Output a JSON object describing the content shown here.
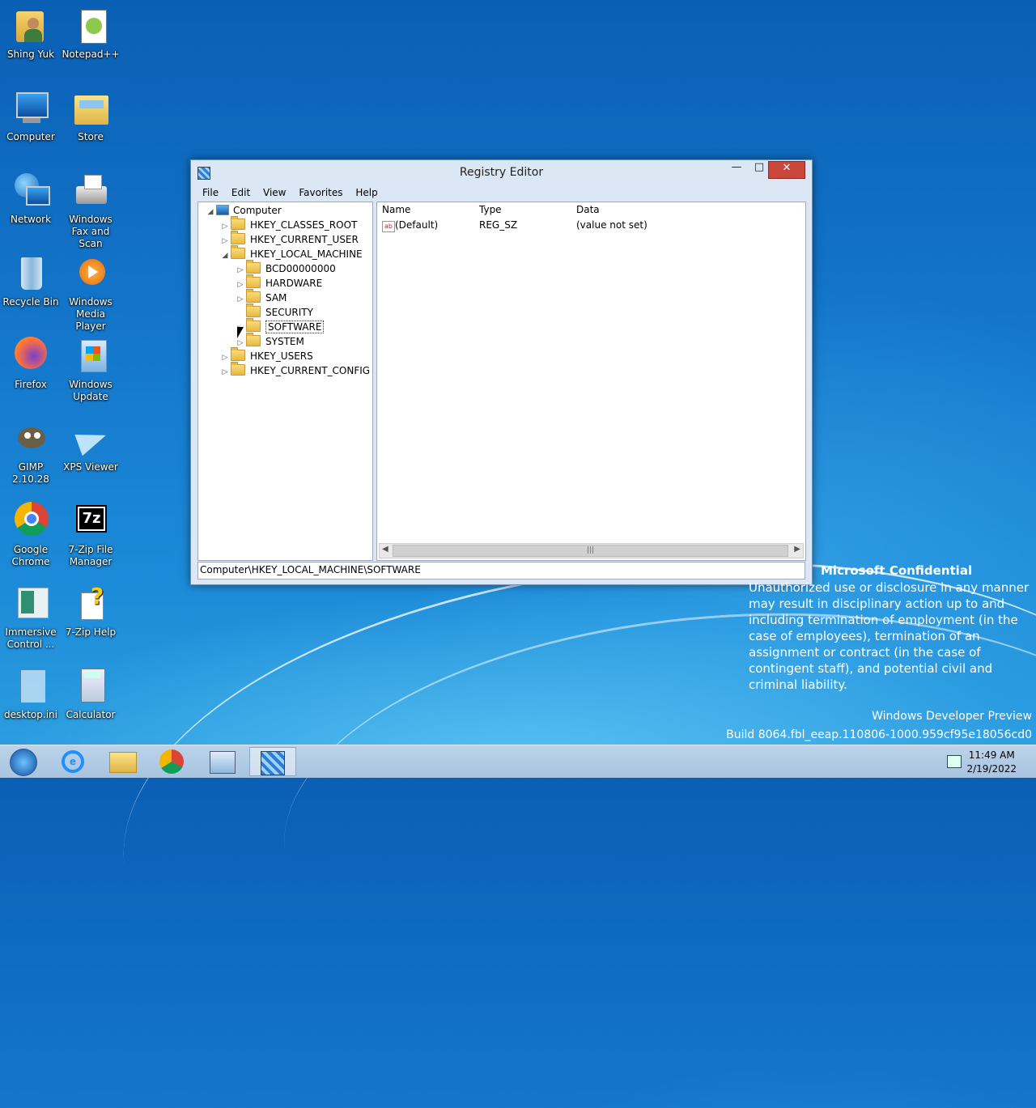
{
  "desktop": {
    "icons": [
      {
        "label": "Shing Yuk",
        "icon": "user-folder-icon"
      },
      {
        "label": "Notepad++",
        "icon": "notepadpp-icon"
      },
      {
        "label": "Computer",
        "icon": "computer-icon"
      },
      {
        "label": "Store",
        "icon": "store-folder-icon"
      },
      {
        "label": "Network",
        "icon": "network-icon"
      },
      {
        "label": "Windows Fax and Scan",
        "icon": "fax-icon"
      },
      {
        "label": "Recycle Bin",
        "icon": "recycle-bin-icon"
      },
      {
        "label": "Windows Media Player",
        "icon": "media-player-icon"
      },
      {
        "label": "Firefox",
        "icon": "firefox-icon"
      },
      {
        "label": "Windows Update",
        "icon": "windows-update-icon"
      },
      {
        "label": "GIMP 2.10.28",
        "icon": "gimp-icon"
      },
      {
        "label": "XPS Viewer",
        "icon": "xps-viewer-icon"
      },
      {
        "label": "Google Chrome",
        "icon": "chrome-icon"
      },
      {
        "label": "7-Zip File Manager",
        "icon": "7zip-icon"
      },
      {
        "label": "Immersive Control ...",
        "icon": "control-panel-icon"
      },
      {
        "label": "7-Zip Help",
        "icon": "help-icon"
      },
      {
        "label": "desktop.ini",
        "icon": "ini-file-icon"
      },
      {
        "label": "Calculator",
        "icon": "calculator-icon"
      }
    ]
  },
  "window": {
    "title": "Registry Editor",
    "menu": [
      "File",
      "Edit",
      "View",
      "Favorites",
      "Help"
    ],
    "tree": {
      "root": "Computer",
      "hives": [
        "HKEY_CLASSES_ROOT",
        "HKEY_CURRENT_USER",
        "HKEY_LOCAL_MACHINE"
      ],
      "hklm_children": [
        "BCD00000000",
        "HARDWARE",
        "SAM",
        "SECURITY",
        "SOFTWARE",
        "SYSTEM"
      ],
      "hives_after": [
        "HKEY_USERS",
        "HKEY_CURRENT_CONFIG"
      ],
      "selected": "SOFTWARE"
    },
    "list": {
      "columns": [
        "Name",
        "Type",
        "Data"
      ],
      "rows": [
        {
          "name": "(Default)",
          "type": "REG_SZ",
          "data": "(value not set)"
        }
      ]
    },
    "status": "Computer\\HKEY_LOCAL_MACHINE\\SOFTWARE"
  },
  "watermark": {
    "title": "Microsoft Confidential",
    "text": "Unauthorized use or disclosure in any manner may result in disciplinary action up to and including termination of employment (in the case of employees), termination of an assignment or contract (in the case of contingent staff), and potential civil and criminal liability.",
    "edition": "Windows Developer Preview",
    "build": "Build 8064.fbl_eeap.110806-1000.959cf95e18056cd0"
  },
  "taskbar": {
    "time": "11:49 AM",
    "date": "2/19/2022",
    "colors": {
      "accent": "#1478cc",
      "close": "#c9483b"
    }
  }
}
